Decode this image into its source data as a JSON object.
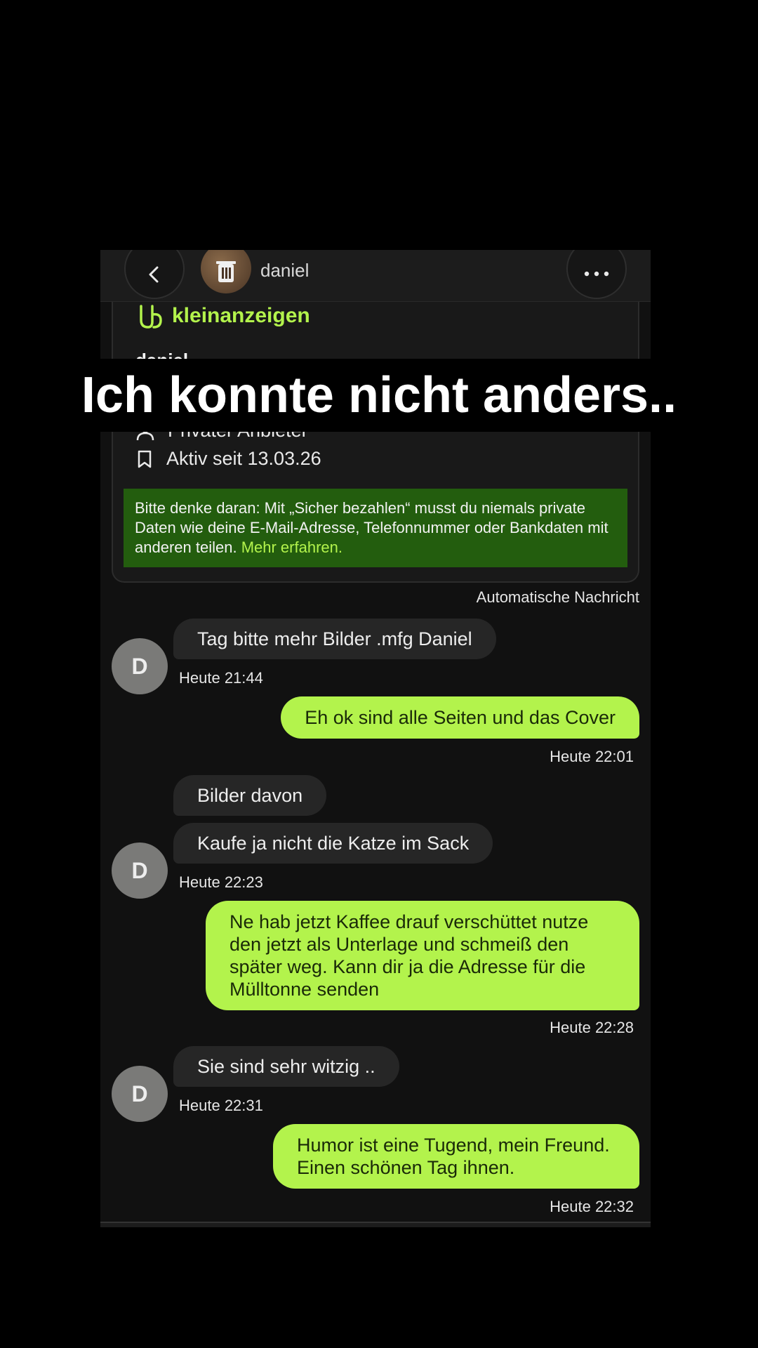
{
  "header": {
    "name": "daniel"
  },
  "listing": {
    "brand": "kleinanzeigen",
    "seller_name": "daniel",
    "seller_type": "Privater Anbieter",
    "active_since": "Aktiv seit 13.03.26",
    "notice_text": "Bitte denke daran: Mit „Sicher bezahlen“ musst du niemals private Daten wie deine E-Mail-Adresse, Telefonnummer oder Bankdaten mit anderen teilen.",
    "notice_link": "Mehr erfahren."
  },
  "auto_message_label": "Automatische Nachricht",
  "avatar_letter": "D",
  "messages": [
    {
      "text": "Tag bitte mehr Bilder .mfg Daniel",
      "time": "Heute 21:44"
    },
    {
      "text": "Eh ok sind alle Seiten und das Cover",
      "time": "Heute 22:01"
    },
    {
      "text": "Bilder davon"
    },
    {
      "text": "Kaufe ja nicht die Katze im Sack",
      "time": "Heute 22:23"
    },
    {
      "text": "Ne hab jetzt Kaffee drauf verschüttet nutze den jetzt als Unterlage und schmeiß den später weg. Kann dir ja die Adresse für die Mülltonne senden",
      "time": "Heute 22:28"
    },
    {
      "text": "Sie sind sehr witzig ..",
      "time": "Heute 22:31"
    },
    {
      "text": "Humor ist eine Tugend, mein Freund. Einen schönen Tag ihnen.",
      "time": "Heute 22:32"
    }
  ],
  "overlay_caption": "Ich konnte nicht anders..",
  "colors": {
    "accent": "#b3f34c",
    "notice_bg": "#235d0e",
    "incoming_bubble": "#262626"
  }
}
